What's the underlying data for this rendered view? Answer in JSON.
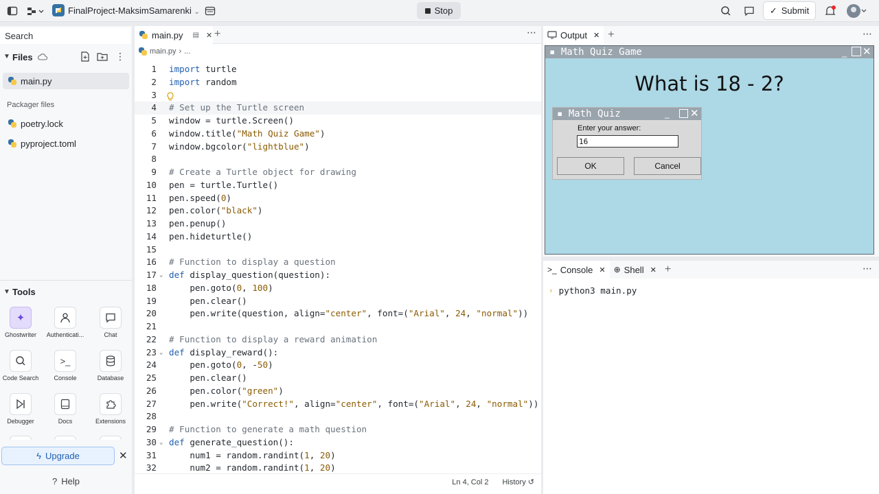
{
  "topbar": {
    "project_name": "FinalProject-MaksimSamarenki",
    "stop_label": "Stop",
    "submit_label": "Submit"
  },
  "sidebar": {
    "search_placeholder": "Search",
    "files_label": "Files",
    "files": [
      "main.py"
    ],
    "packager_label": "Packager files",
    "packager_files": [
      "poetry.lock",
      "pyproject.toml"
    ],
    "tools_label": "Tools",
    "tools": [
      {
        "label": "Ghostwriter",
        "icon": "ghostwriter-icon"
      },
      {
        "label": "Authenticati...",
        "icon": "user-icon"
      },
      {
        "label": "Chat",
        "icon": "chat-icon"
      },
      {
        "label": "Code Search",
        "icon": "search-icon"
      },
      {
        "label": "Console",
        "icon": "terminal-icon"
      },
      {
        "label": "Database",
        "icon": "database-icon"
      },
      {
        "label": "Debugger",
        "icon": "debugger-icon"
      },
      {
        "label": "Docs",
        "icon": "docs-icon"
      },
      {
        "label": "Extensions",
        "icon": "puzzle-icon"
      }
    ],
    "upgrade_label": "Upgrade",
    "help_label": "Help"
  },
  "editor": {
    "tab_label": "main.py",
    "breadcrumb_file": "main.py",
    "breadcrumb_more": "...",
    "lines": [
      "import turtle",
      "import random",
      "",
      "# Set up the Turtle screen",
      "window = turtle.Screen()",
      "window.title(\"Math Quiz Game\")",
      "window.bgcolor(\"lightblue\")",
      "",
      "# Create a Turtle object for drawing",
      "pen = turtle.Turtle()",
      "pen.speed(0)",
      "pen.color(\"black\")",
      "pen.penup()",
      "pen.hideturtle()",
      "",
      "# Function to display a question",
      "def display_question(question):",
      "    pen.goto(0, 100)",
      "    pen.clear()",
      "    pen.write(question, align=\"center\", font=(\"Arial\", 24, \"normal\"))",
      "",
      "# Function to display a reward animation",
      "def display_reward():",
      "    pen.goto(0, -50)",
      "    pen.clear()",
      "    pen.color(\"green\")",
      "    pen.write(\"Correct!\", align=\"center\", font=(\"Arial\", 24, \"normal\"))",
      "",
      "# Function to generate a math question",
      "def generate_question():",
      "    num1 = random.randint(1, 20)",
      "    num2 = random.randint(1, 20)"
    ],
    "status_position": "Ln 4, Col 2",
    "status_history": "History"
  },
  "output": {
    "tab_label": "Output",
    "window_title": "Math Quiz Game",
    "question": "What is 18 - 2?",
    "dialog_title": "Math Quiz",
    "dialog_prompt": "Enter your answer:",
    "answer_value": "16",
    "ok_label": "OK",
    "cancel_label": "Cancel"
  },
  "console": {
    "tab_console": "Console",
    "tab_shell": "Shell",
    "command": "python3 main.py"
  }
}
